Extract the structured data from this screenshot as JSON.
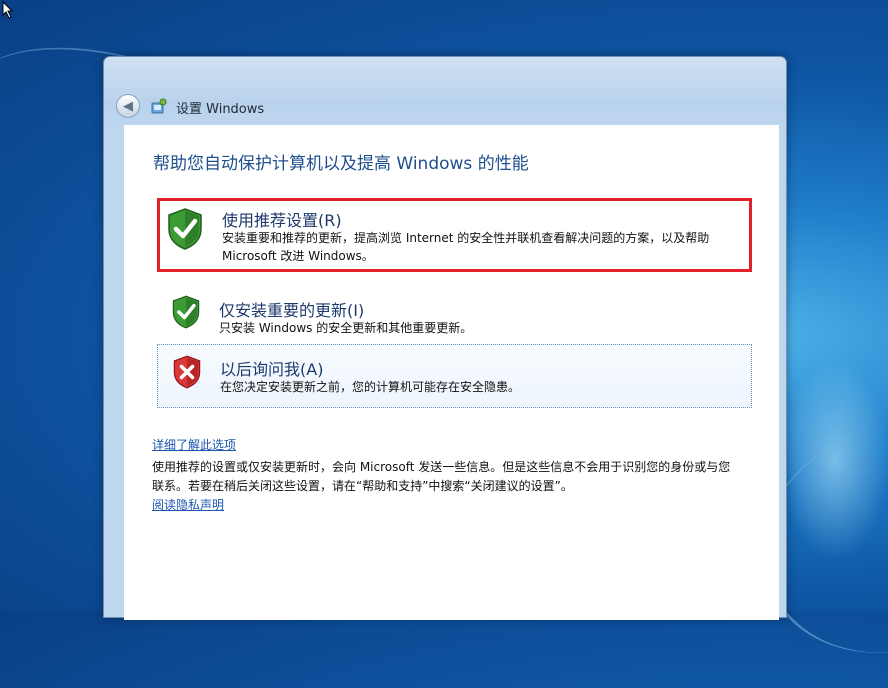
{
  "window": {
    "title": "设置 Windows"
  },
  "page": {
    "heading": "帮助您自动保护计算机以及提高 Windows 的性能"
  },
  "options": [
    {
      "title": "使用推荐设置(R)",
      "description": "安装重要和推荐的更新，提高浏览 Internet 的安全性并联机查看解决问题的方案，以及帮助 Microsoft 改进 Windows。",
      "icon": "green-shield-check-icon",
      "highlighted": true
    },
    {
      "title": "仅安装重要的更新(I)",
      "description": "只安装 Windows 的安全更新和其他重要更新。",
      "icon": "green-shield-check-icon"
    },
    {
      "title": "以后询问我(A)",
      "description": "在您决定安装更新之前，您的计算机可能存在安全隐患。",
      "icon": "red-shield-x-icon"
    }
  ],
  "footer": {
    "learn_more": "详细了解此选项",
    "info_text": "使用推荐的设置或仅安装更新时，会向 Microsoft 发送一些信息。但是这些信息不会用于识别您的身份或与您联系。若要在稍后关闭这些设置，请在“帮助和支持”中搜索“关闭建议的设置”。",
    "privacy_link": "阅读隐私声明"
  },
  "colors": {
    "highlight_border": "#e0202a",
    "heading": "#1e4e8c",
    "link": "#1a55b0"
  }
}
